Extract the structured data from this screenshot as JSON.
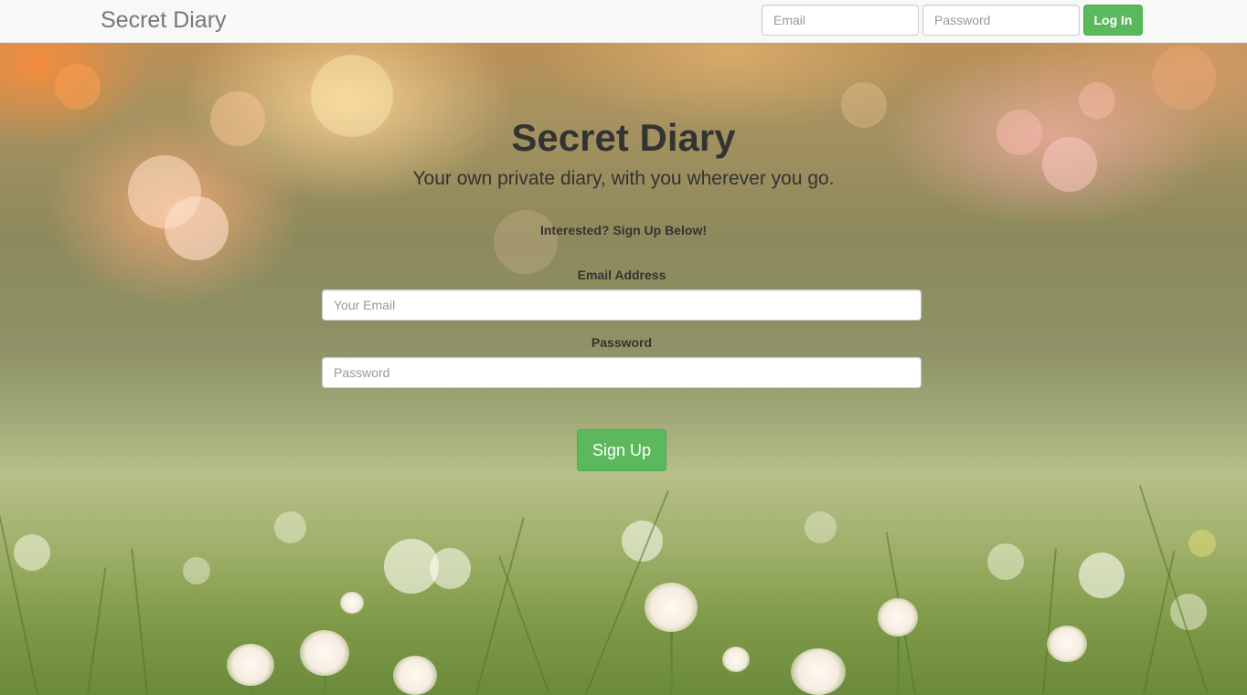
{
  "navbar": {
    "brand": "Secret Diary",
    "email_placeholder": "Email",
    "password_placeholder": "Password",
    "login_label": "Log In"
  },
  "hero": {
    "title": "Secret Diary",
    "subtitle": "Your own private diary, with you wherever you go.",
    "prompt": "Interested? Sign Up Below!"
  },
  "signup_form": {
    "email_label": "Email Address",
    "email_placeholder": "Your Email",
    "password_label": "Password",
    "password_placeholder": "Password",
    "submit_label": "Sign Up"
  },
  "colors": {
    "accent": "#5cb85c",
    "navbar_bg": "#f8f8f8",
    "text": "#333333"
  }
}
